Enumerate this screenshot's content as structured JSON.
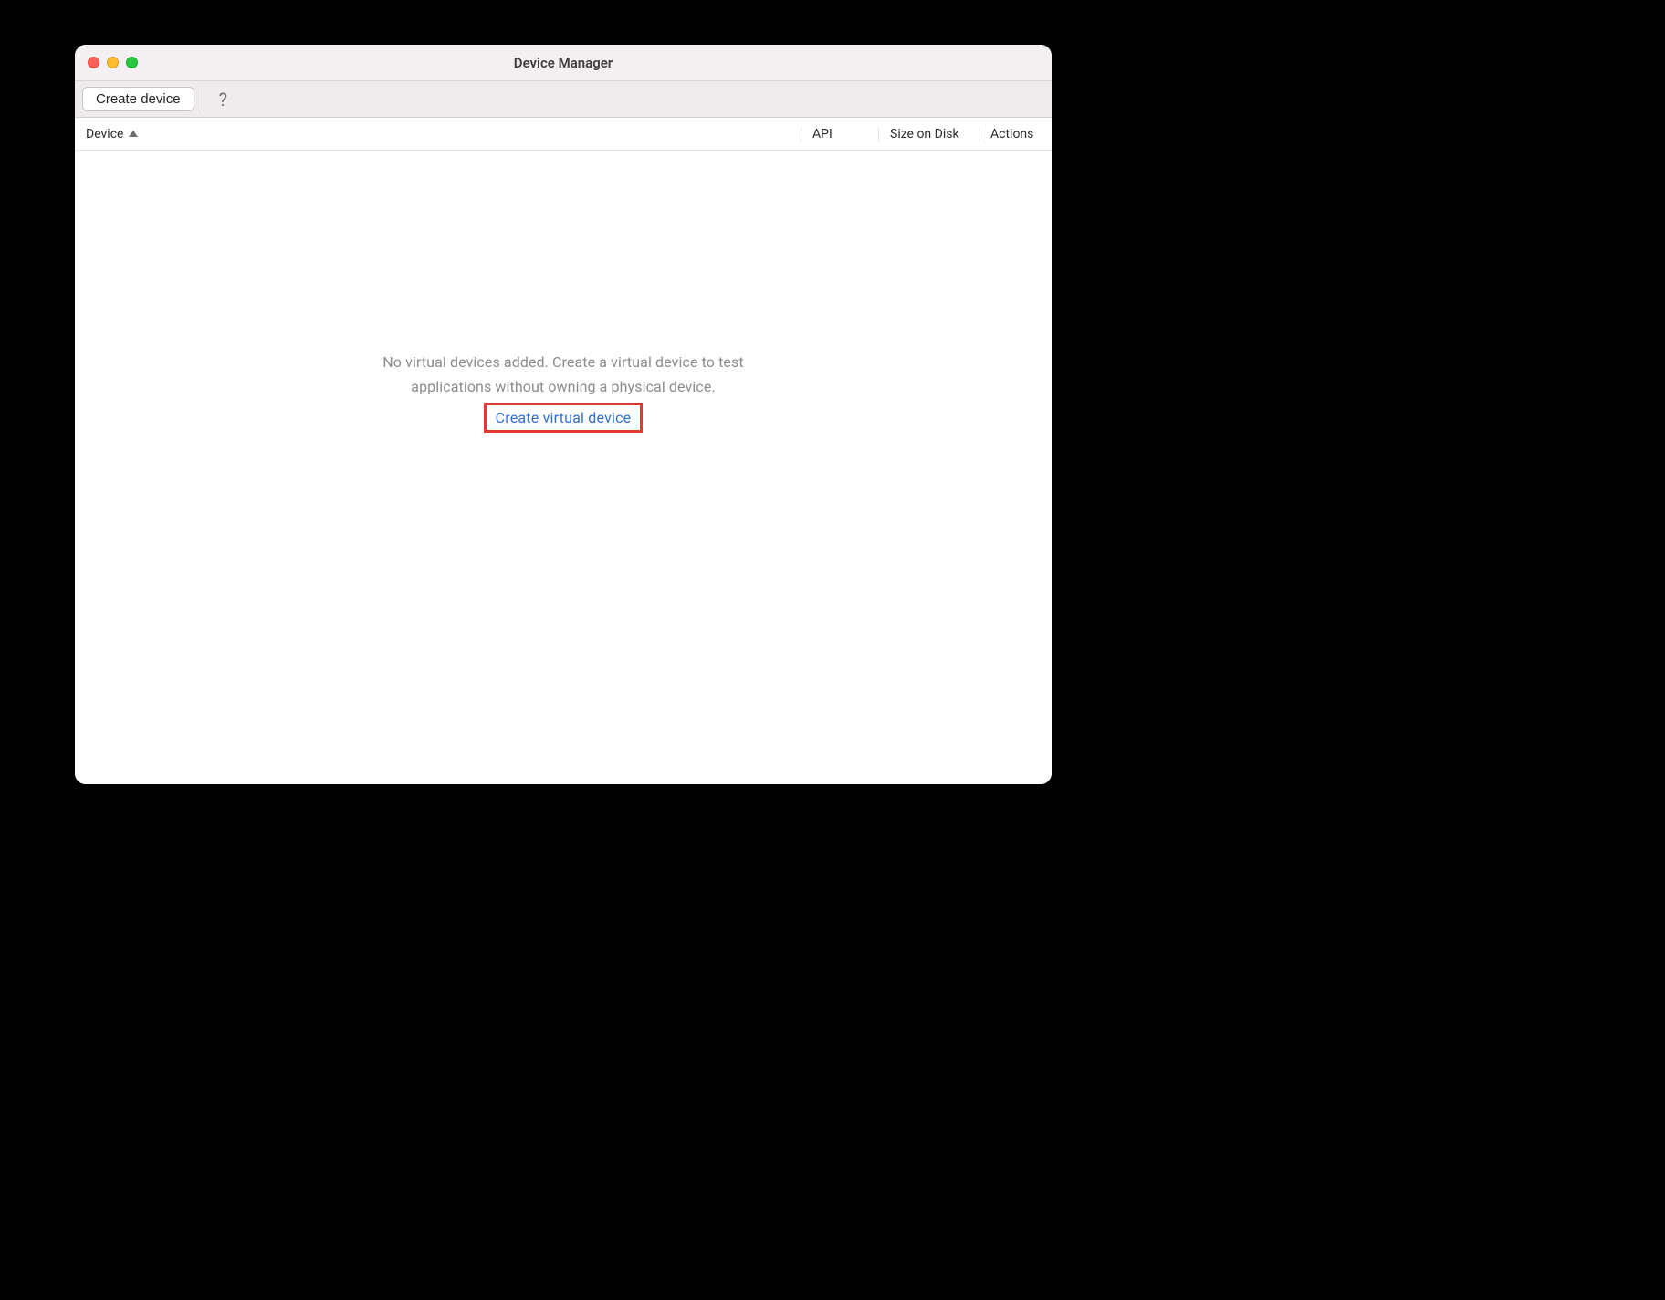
{
  "window": {
    "title": "Device Manager"
  },
  "toolbar": {
    "create_label": "Create device"
  },
  "columns": {
    "device": "Device",
    "api": "API",
    "size": "Size on Disk",
    "actions": "Actions"
  },
  "empty": {
    "line1": "No virtual devices added. Create a virtual device to test",
    "line2": "applications without owning a physical device.",
    "link": "Create virtual device"
  }
}
